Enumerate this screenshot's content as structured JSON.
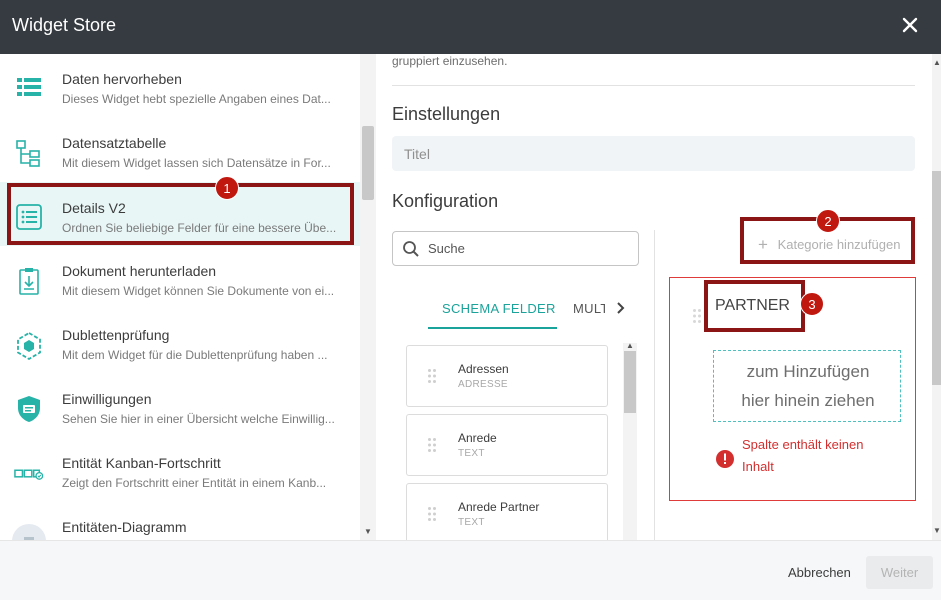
{
  "window": {
    "title": "Widget Store"
  },
  "widgets": [
    {
      "name": "Daten hervorheben",
      "desc": "Dieses Widget hebt spezielle Angaben eines Dat...",
      "icon": "list-highlight-icon"
    },
    {
      "name": "Datensatztabelle",
      "desc": "Mit diesem Widget lassen sich Datensätze in For...",
      "icon": "record-tree-icon"
    },
    {
      "name": "Details V2",
      "desc": "Ordnen Sie beliebige Felder für eine bessere Übe...",
      "icon": "details-list-icon"
    },
    {
      "name": "Dokument herunterladen",
      "desc": "Mit diesem Widget können Sie Dokumente von ei...",
      "icon": "document-download-icon"
    },
    {
      "name": "Dublettenprüfung",
      "desc": "Mit dem Widget für die Dublettenprüfung haben ...",
      "icon": "duplicate-hex-icon"
    },
    {
      "name": "Einwilligungen",
      "desc": "Sehen Sie hier in einer Übersicht welche Einwillig...",
      "icon": "consent-shield-icon"
    },
    {
      "name": "Entität Kanban-Fortschritt",
      "desc": "Zeigt den Fortschritt einer Entität in einem Kanb...",
      "icon": "kanban-progress-icon"
    },
    {
      "name": "Entitäten-Diagramm",
      "desc": "",
      "icon": "entity-diagram-icon"
    }
  ],
  "main": {
    "grouped_text": "gruppiert einzusehen.",
    "settings_heading": "Einstellungen",
    "title_placeholder": "Titel",
    "config_heading": "Konfiguration",
    "search_placeholder": "Suche",
    "tabs": [
      "SCHEMA FELDER",
      "MULT"
    ],
    "fields": [
      {
        "name": "Adressen",
        "type": "ADRESSE"
      },
      {
        "name": "Anrede",
        "type": "TEXT"
      },
      {
        "name": "Anrede Partner",
        "type": "TEXT"
      }
    ],
    "add_category": "Kategorie hinzufügen",
    "column": {
      "name": "PARTNER",
      "dropzone_line1": "zum Hinzufügen",
      "dropzone_line2": "hier hinein ziehen",
      "error_line1": "Spalte enthält keinen",
      "error_line2": "Inhalt"
    }
  },
  "annotations": [
    "1",
    "2",
    "3"
  ],
  "footer": {
    "back": "Abbrechen",
    "next": "Weiter"
  },
  "colors": {
    "accent": "#1aa39a",
    "annotation": "#8b1414",
    "error": "#d32f2f",
    "titlebar": "#353b40"
  }
}
